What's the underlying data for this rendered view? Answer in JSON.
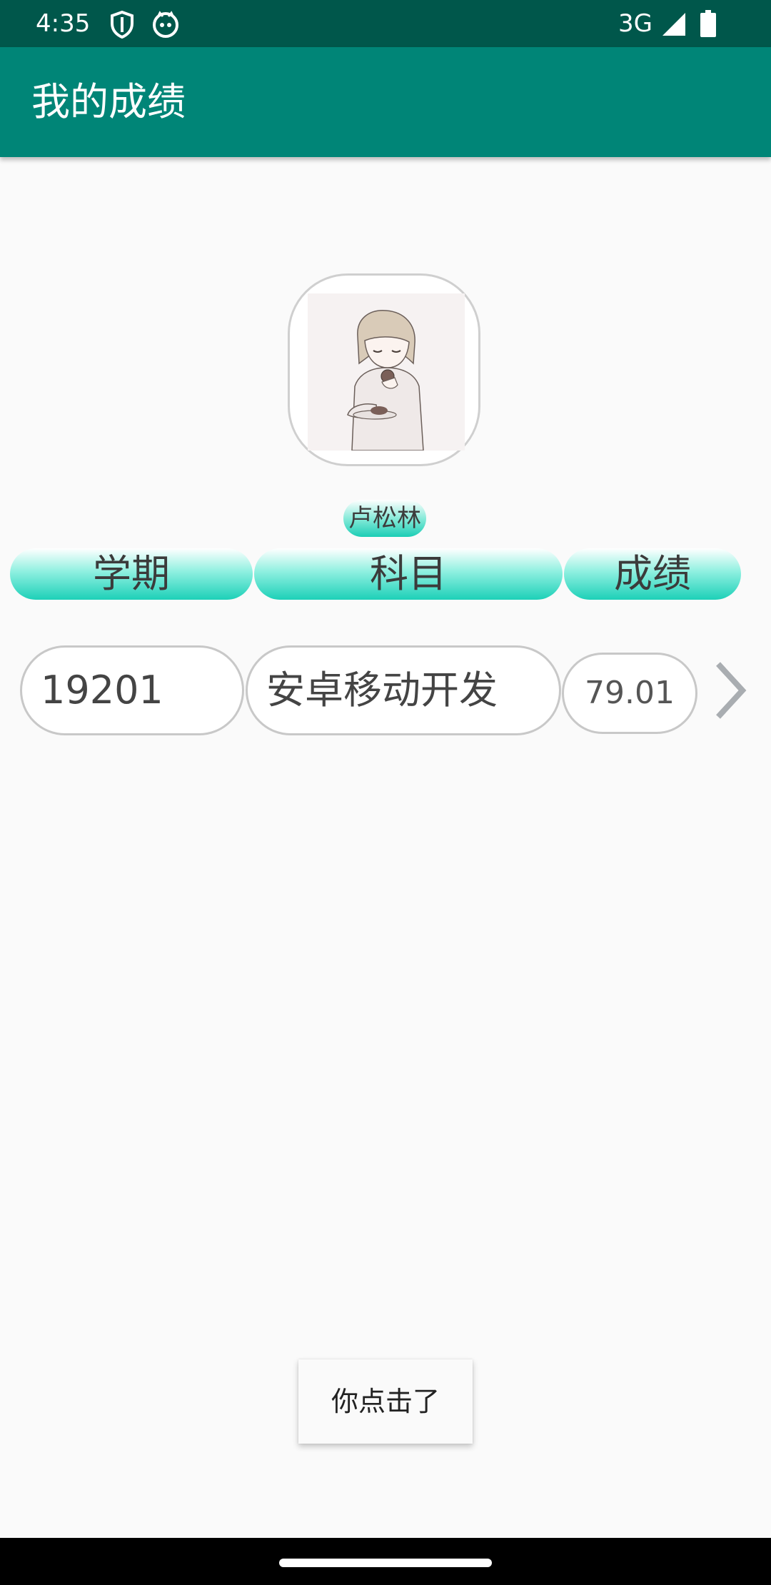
{
  "status_bar": {
    "time": "4:35",
    "network": "3G",
    "icons": [
      "shield-icon",
      "cat-icon",
      "signal-icon",
      "battery-icon"
    ]
  },
  "app_bar": {
    "title": "我的成绩"
  },
  "profile": {
    "name": "卢松林",
    "avatar": "avatar-illustration"
  },
  "table": {
    "headers": [
      "学期",
      "科目",
      "成绩"
    ],
    "rows": [
      {
        "term": "19201",
        "subject": "安卓移动开发",
        "score": "79.01"
      }
    ]
  },
  "toast": {
    "message": "你点击了"
  },
  "colors": {
    "status_bar": "#00574b",
    "app_bar": "#008577",
    "accent_teal": "#1dd0b8",
    "background": "#fafafa"
  }
}
